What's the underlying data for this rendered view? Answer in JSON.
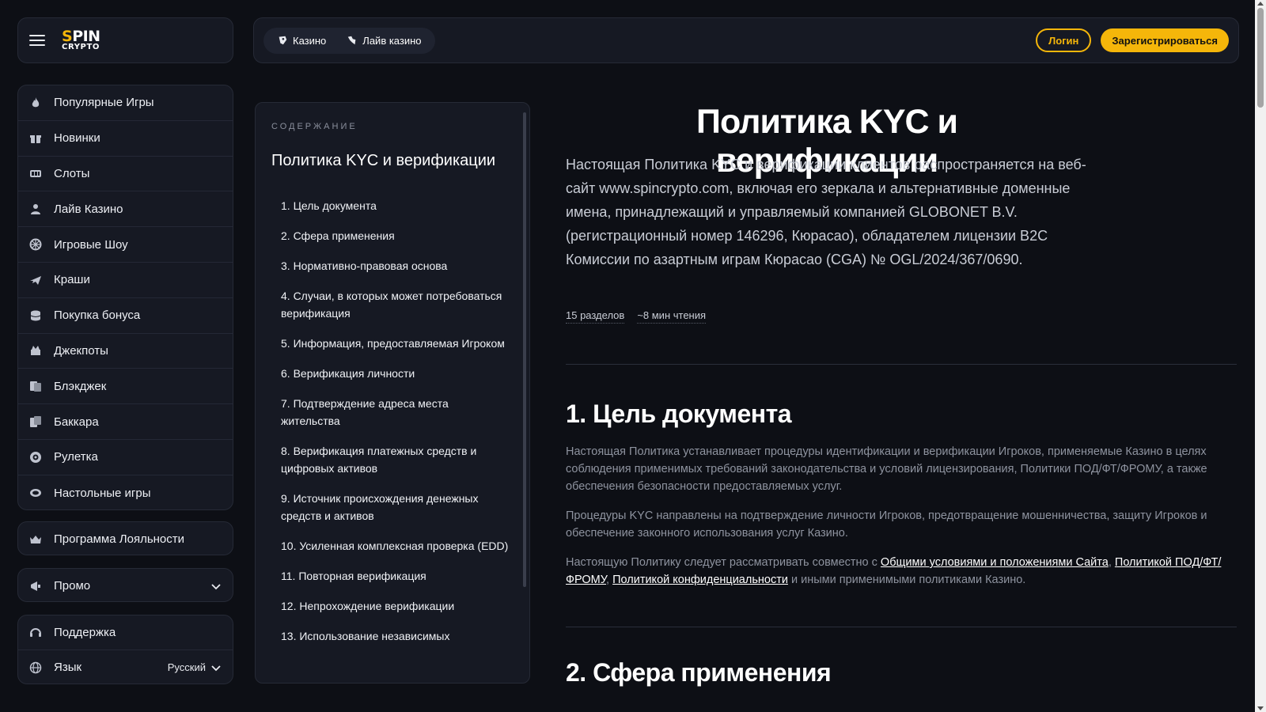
{
  "logo": {
    "line1": "SPIN",
    "line2": "CRYPTO"
  },
  "topbar": {
    "tabs": [
      {
        "label": "Казино",
        "icon": "casino-chip-icon"
      },
      {
        "label": "Лайв казино",
        "icon": "live-dealer-icon"
      }
    ],
    "login_label": "Логин",
    "register_label": "Зарегистрироваться"
  },
  "sidebar": {
    "items": [
      {
        "label": "Популярные Игры",
        "icon": "flame-icon"
      },
      {
        "label": "Новинки",
        "icon": "gift-box-icon"
      },
      {
        "label": "Слоты",
        "icon": "slot-machine-icon"
      },
      {
        "label": "Лайв Казино",
        "icon": "dealer-icon"
      },
      {
        "label": "Игровые Шоу",
        "icon": "wheel-icon"
      },
      {
        "label": "Краши",
        "icon": "airplane-icon"
      },
      {
        "label": "Покупка бонуса",
        "icon": "coins-icon"
      },
      {
        "label": "Джекпоты",
        "icon": "jackpot-icon"
      },
      {
        "label": "Блэкджек",
        "icon": "blackjack-cards-icon"
      },
      {
        "label": "Баккара",
        "icon": "baccarat-cards-icon"
      },
      {
        "label": "Рулетка",
        "icon": "roulette-icon"
      },
      {
        "label": "Настольные игры",
        "icon": "table-games-icon"
      }
    ],
    "loyalty": {
      "label": "Программа Лояльности",
      "icon": "crown-icon"
    },
    "promo": {
      "label": "Промо",
      "icon": "megaphone-icon"
    },
    "support": {
      "label": "Поддержка",
      "icon": "headset-icon"
    },
    "language": {
      "label": "Язык",
      "value": "Русский",
      "icon": "globe-icon"
    }
  },
  "toc": {
    "heading": "СОДЕРЖАНИЕ",
    "title": "Политика KYC и верификации",
    "items": [
      "1. Цель документа",
      "2. Сфера применения",
      "3. Нормативно-правовая основа",
      "4. Случаи, в которых может потребоваться верификация",
      "5. Информация, предоставляемая Игроком",
      "6. Верификация личности",
      "7. Подтверждение адреса места жительства",
      "8. Верификация платежных средств и цифровых активов",
      "9. Источник происхождения денежных средств и активов",
      "10. Усиленная комплексная проверка (EDD)",
      "11. Повторная верификация",
      "12. Непрохождение верификации",
      "13. Использование независимых"
    ]
  },
  "content": {
    "title": "Политика KYC и верификации",
    "intro": "Настоящая Политика KYC и верификации клиентов распространяется на веб-сайт www.spincrypto.com, включая его зеркала и альтернативные доменные имена, принадлежащий и управляемый компанией GLOBONET B.V. (регистрационный номер 146296, Кюрасао), обладателем лицензии B2C Комиссии по азартным играм Кюрасао (CGA) № OGL/2024/367/0690.",
    "sections_count": "15 разделов",
    "read_time": "~8 мин чтения",
    "section1_title": "1. Цель документа",
    "section1_p1": "Настоящая Политика устанавливает процедуры идентификации и верификации Игроков, применяемые Казино в целях соблюдения применимых требований законодательства и условий лицензирования, Политики ПОД/ФТ/ФРОМУ, а также обеспечения безопасности предоставляемых услуг.",
    "section1_p2": "Процедуры KYC направлены на подтверждение личности Игроков, предотвращение мошенничества, защиту Игроков и обеспечение законного использования услуг Казино.",
    "section1_p3_start": "Настоящую Политику следует рассматривать совместно с ",
    "link_terms": "Общими условиями и положениями Сайта",
    "sep1": ", ",
    "link_aml": "Политикой ПОД/ФТ/ФРОМУ",
    "sep2": ", ",
    "link_privacy": "Политикой конфиденциальности",
    "section1_p3_end": " и иными применимыми политиками Казино.",
    "section2_title": "2. Сфера применения"
  },
  "colors": {
    "accent": "#f5b60a",
    "background": "#0d0f15",
    "panel": "#161923"
  }
}
